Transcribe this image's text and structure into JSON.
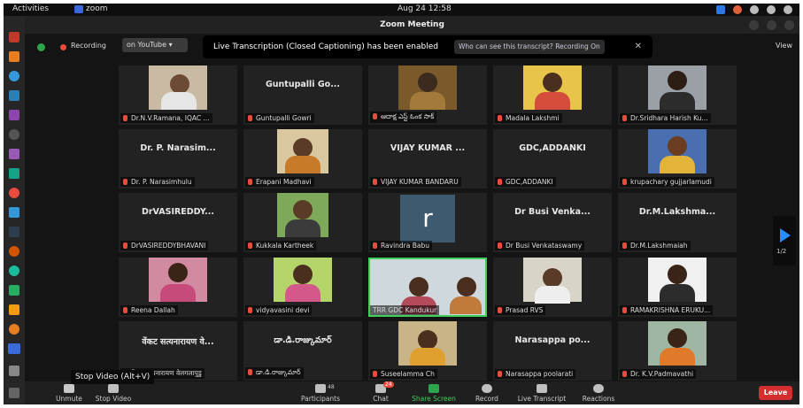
{
  "topbar": {
    "activities": "Activities",
    "app_name": "zoom",
    "datetime": "Aug 24  12:58"
  },
  "window": {
    "title": "Zoom Meeting"
  },
  "infobar": {
    "recording": "Recording",
    "youtube": "on YouTube  ▾",
    "banner_text": "Live Transcription (Closed Captioning) has been enabled",
    "banner_link": "Who can see this transcript? Recording On",
    "banner_close": "✕",
    "view": "View"
  },
  "participants": [
    "Dr.N.V.Ramana, IQAC ...",
    "Guntupalli Gowri",
    "ఆదాక్ష ఎస్ట్ ఓంక సాక్",
    "Madala Lakshmi",
    "Dr.Sridhara Harish Ku...",
    "Dr. P. Narasimhulu",
    "Erapani Madhavi",
    "VIJAY KUMAR BANDARU",
    "GDC,ADDANKI",
    "krupachary gujjarlamudi",
    "DrVASIREDDYBHAVANI",
    "Kukkala Kartheek",
    "Ravindra Babu",
    "Dr Busi Venkataswamy",
    "Dr.M.Lakshmaiah",
    "Reena Dallah",
    "vidyavasini devi",
    "TRR GDC Kandukur",
    "Prasad RVS",
    "RAMAKRISHNA ERUKU...",
    "वेंकट सत्यनारायण वेलगलापुडु",
    "డా.డి.రాజ్కుమార్",
    "Suseelamma Ch",
    "Narasappa poolarati",
    "Dr. K.V.Padmavathi"
  ],
  "tile_names": {
    "t1": "Guntupalli Go...",
    "t5": "Dr. P. Narasim...",
    "t7": "VIJAY KUMAR ...",
    "t8": "GDC,ADDANKI",
    "t10": "DrVASIREDDY...",
    "t13": "Dr Busi Venka...",
    "t14": "Dr.M.Lakshma...",
    "t20": "वेंकट सत्यनारायण वे...",
    "t21": "డా.డి.రాజ్కుమార్",
    "t23": "Narasappa po..."
  },
  "avatar_letter": "r",
  "pagination": "1/2",
  "tooltip": "Stop Video (Alt+V)",
  "toolbar": {
    "unmute": "Unmute",
    "stop_video": "Stop Video",
    "participants": "Participants",
    "participant_count": "48",
    "chat": "Chat",
    "chat_badge": "24",
    "share": "Share Screen",
    "record": "Record",
    "transcript": "Live Transcript",
    "reactions": "Reactions",
    "leave": "Leave"
  },
  "colors": {
    "active_speaker": "#3fcf5a",
    "leave": "#d32f2f",
    "recording": "#e84c3d"
  }
}
